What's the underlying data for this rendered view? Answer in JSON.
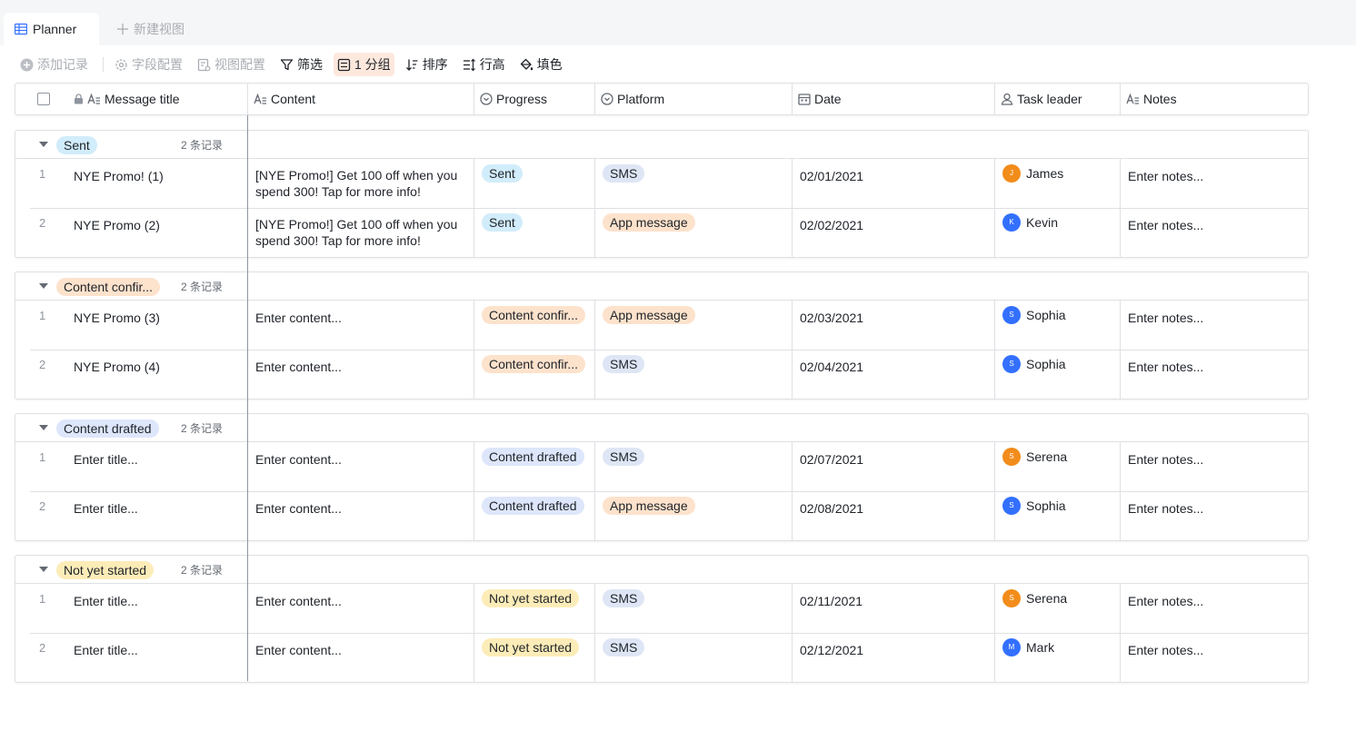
{
  "tabs": {
    "active": {
      "label": "Planner",
      "icon": "grid-table-icon"
    },
    "new_view": {
      "label": "新建视图",
      "icon": "plus-icon"
    }
  },
  "toolbar": {
    "add_record": "添加记录",
    "field_config": "字段配置",
    "view_config": "视图配置",
    "filter": "筛选",
    "group": "1 分组",
    "sort": "排序",
    "row_height": "行高",
    "fill_color": "填色"
  },
  "columns": {
    "title": "Message title",
    "content": "Content",
    "progress": "Progress",
    "platform": "Platform",
    "date": "Date",
    "leader": "Task leader",
    "notes": "Notes"
  },
  "colors": {
    "sent_bg": "#d1ecfa",
    "confirm_bg": "#fde2cc",
    "drafted_bg": "#dde6fa",
    "notstarted_bg": "#fcecb8",
    "sms_bg": "#dee6f5",
    "app_bg": "#fde2cc",
    "avatar_orange": "#f28c1a",
    "avatar_blue": "#3370ff"
  },
  "groups": [
    {
      "label": "Sent",
      "count": "2 条记录",
      "tag_bg": "#d1ecfa",
      "rows": [
        {
          "num": "1",
          "title": "NYE Promo! (1)",
          "content": "[NYE Promo!] Get 100 off when you spend 300! Tap for more info!",
          "progress": "Sent",
          "progress_bg": "#d1ecfa",
          "platform": "SMS",
          "platform_bg": "#dee6f5",
          "date": "02/01/2021",
          "leader": "James",
          "initial": "J",
          "avatar_color": "#f28c1a",
          "notes": "Enter notes..."
        },
        {
          "num": "2",
          "title": "NYE Promo (2)",
          "content": "[NYE Promo!] Get 100 off when you spend 300! Tap for more info!",
          "progress": "Sent",
          "progress_bg": "#d1ecfa",
          "platform": "App message",
          "platform_bg": "#fde2cc",
          "date": "02/02/2021",
          "leader": "Kevin",
          "initial": "K",
          "avatar_color": "#3370ff",
          "notes": "Enter notes..."
        }
      ]
    },
    {
      "label": "Content confir...",
      "count": "2 条记录",
      "tag_bg": "#fde2cc",
      "rows": [
        {
          "num": "1",
          "title": "NYE Promo (3)",
          "content": "Enter content...",
          "progress": "Content confir...",
          "progress_bg": "#fde2cc",
          "platform": "App message",
          "platform_bg": "#fde2cc",
          "date": "02/03/2021",
          "leader": "Sophia",
          "initial": "S",
          "avatar_color": "#3370ff",
          "notes": "Enter notes..."
        },
        {
          "num": "2",
          "title": "NYE Promo (4)",
          "content": "Enter content...",
          "progress": "Content confir...",
          "progress_bg": "#fde2cc",
          "platform": "SMS",
          "platform_bg": "#dee6f5",
          "date": "02/04/2021",
          "leader": "Sophia",
          "initial": "S",
          "avatar_color": "#3370ff",
          "notes": "Enter notes..."
        }
      ]
    },
    {
      "label": "Content drafted",
      "count": "2 条记录",
      "tag_bg": "#dde6fa",
      "rows": [
        {
          "num": "1",
          "title": "Enter title...",
          "content": "Enter content...",
          "progress": "Content drafted",
          "progress_bg": "#dde6fa",
          "platform": "SMS",
          "platform_bg": "#dee6f5",
          "date": "02/07/2021",
          "leader": "Serena",
          "initial": "S",
          "avatar_color": "#f28c1a",
          "notes": "Enter notes..."
        },
        {
          "num": "2",
          "title": "Enter title...",
          "content": "Enter content...",
          "progress": "Content drafted",
          "progress_bg": "#dde6fa",
          "platform": "App message",
          "platform_bg": "#fde2cc",
          "date": "02/08/2021",
          "leader": "Sophia",
          "initial": "S",
          "avatar_color": "#3370ff",
          "notes": "Enter notes..."
        }
      ]
    },
    {
      "label": "Not yet started",
      "count": "2 条记录",
      "tag_bg": "#fcecb8",
      "rows": [
        {
          "num": "1",
          "title": "Enter title...",
          "content": "Enter content...",
          "progress": "Not yet started",
          "progress_bg": "#fcecb8",
          "platform": "SMS",
          "platform_bg": "#dee6f5",
          "date": "02/11/2021",
          "leader": "Serena",
          "initial": "S",
          "avatar_color": "#f28c1a",
          "notes": "Enter notes..."
        },
        {
          "num": "2",
          "title": "Enter title...",
          "content": "Enter content...",
          "progress": "Not yet started",
          "progress_bg": "#fcecb8",
          "platform": "SMS",
          "platform_bg": "#dee6f5",
          "date": "02/12/2021",
          "leader": "Mark",
          "initial": "M",
          "avatar_color": "#3370ff",
          "notes": "Enter notes..."
        }
      ]
    }
  ]
}
